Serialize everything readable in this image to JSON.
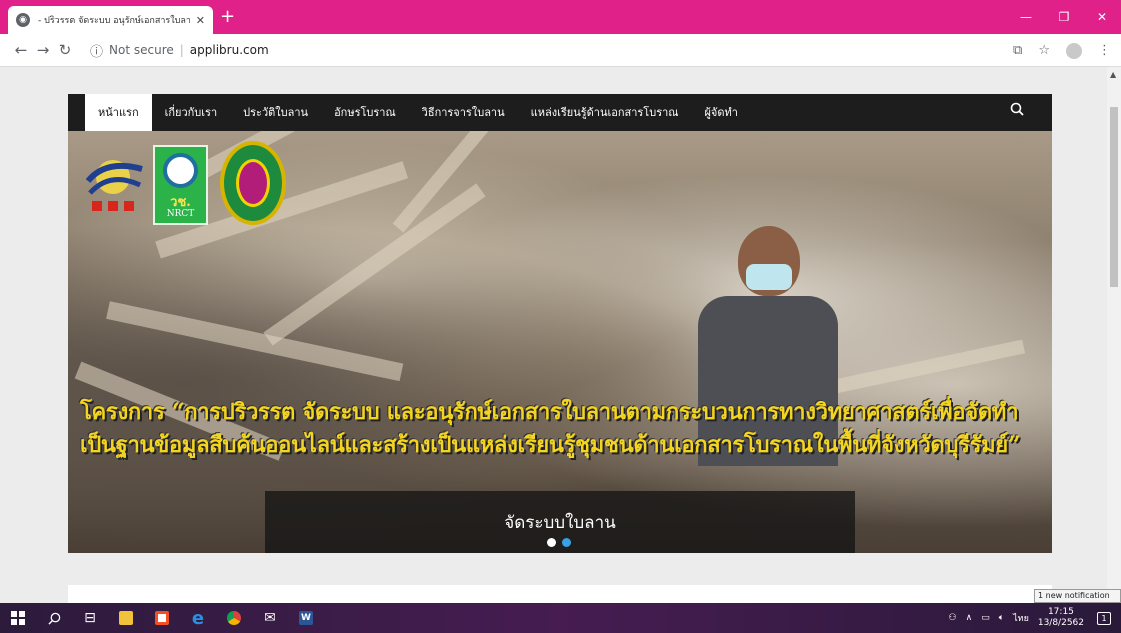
{
  "browser": {
    "tab_title": "- ปริวรรต จัดระบบ อนุรักษ์เอกสารใบลา",
    "new_tab": "+",
    "tab_close": "✕",
    "security": "Not secure",
    "url": "applibru.com"
  },
  "site": {
    "nav": [
      {
        "label": "หน้าแรก"
      },
      {
        "label": "เกี่ยวกับเรา"
      },
      {
        "label": "ประวัติใบลาน"
      },
      {
        "label": "อักษรโบราณ"
      },
      {
        "label": "วิธีการจารใบลาน"
      },
      {
        "label": "แหล่งเรียนรู้ด้านเอกสารโบราณ"
      },
      {
        "label": "ผู้จัดทำ"
      }
    ],
    "logo2_top": "วช.",
    "logo2_bottom": "NRCT",
    "headline": "โครงการ “การปริวรรต จัดระบบ และอนุรักษ์เอกสารใบลานตามกระบวนการทางวิทยาศาสตร์เพื่อจัดทำเป็นฐานข้อมูลสืบค้นออนไลน์และสร้างเป็นแหล่งเรียนรู้ชุมชนด้านเอกสารโบราณในพื้นที่จังหวัดบุรีรัมย์”",
    "slide_caption": "จัดระบบใบลาน",
    "slide_count": 2,
    "slide_active": 2
  },
  "os": {
    "notification_toast": "1 new notification",
    "lang": "ไทย",
    "time": "17:15",
    "date": "13/8/2562",
    "notif_count": "1"
  }
}
